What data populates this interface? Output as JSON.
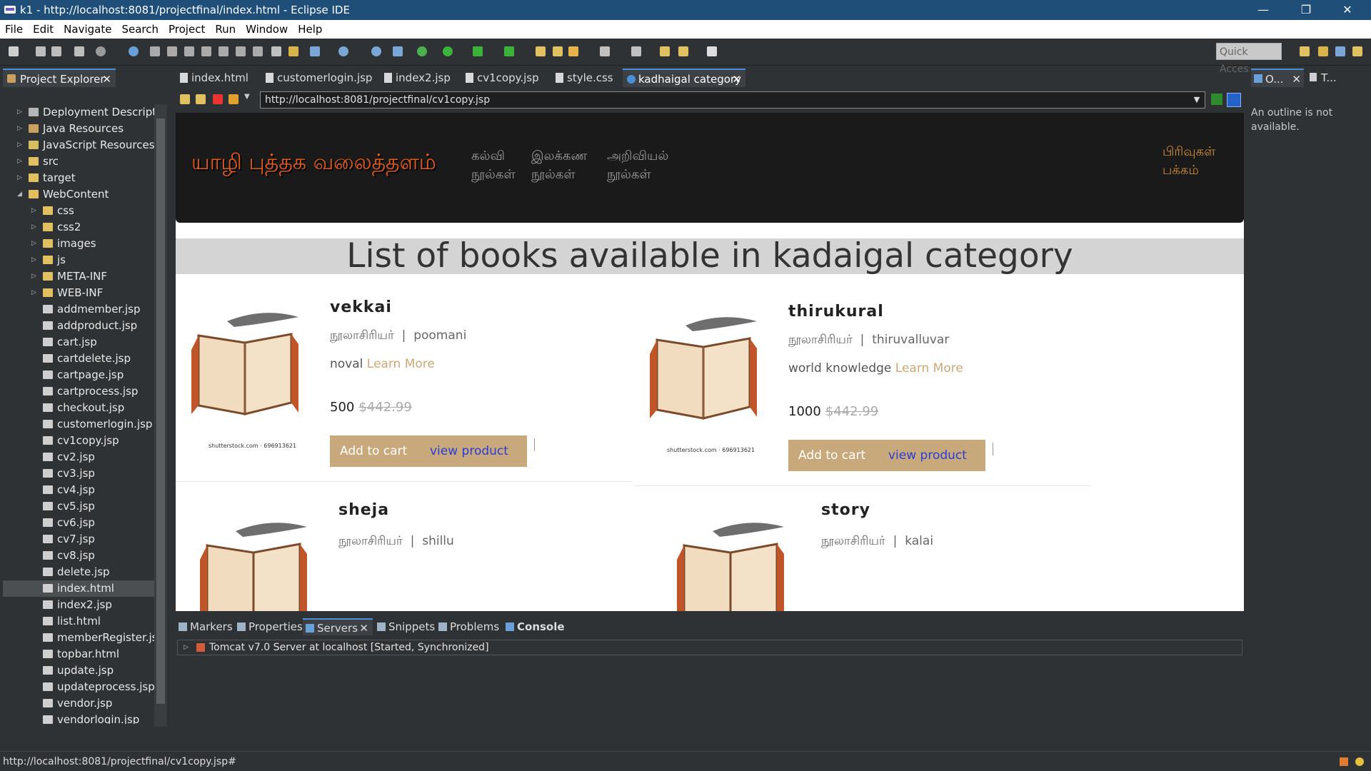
{
  "window": {
    "title": "k1 - http://localhost:8081/projectfinal/index.html - Eclipse IDE",
    "minimize": "—",
    "restore": "❐",
    "close": "✕"
  },
  "menu": [
    "File",
    "Edit",
    "Navigate",
    "Search",
    "Project",
    "Run",
    "Window",
    "Help"
  ],
  "toolbar": {
    "quick_access_placeholder": "Quick Access"
  },
  "explorer": {
    "title": "Project Explorer",
    "close": "✕",
    "items": [
      {
        "label": "Deployment Descriptor",
        "icon": "deployment-icon",
        "arrow": "▷"
      },
      {
        "label": "Java Resources",
        "icon": "java-resources-icon",
        "arrow": "▷"
      },
      {
        "label": "JavaScript Resources",
        "icon": "js-resources-icon",
        "arrow": "▷"
      },
      {
        "label": "src",
        "icon": "folder-icon",
        "arrow": "▷"
      },
      {
        "label": "target",
        "icon": "folder-icon",
        "arrow": "▷"
      },
      {
        "label": "WebContent",
        "icon": "folder-icon",
        "arrow": "◢"
      },
      {
        "label": "css",
        "icon": "folder-icon",
        "arrow": "▷"
      },
      {
        "label": "css2",
        "icon": "folder-icon",
        "arrow": "▷"
      },
      {
        "label": "images",
        "icon": "folder-icon",
        "arrow": "▷"
      },
      {
        "label": "js",
        "icon": "folder-icon",
        "arrow": "▷"
      },
      {
        "label": "META-INF",
        "icon": "folder-icon",
        "arrow": "▷"
      },
      {
        "label": "WEB-INF",
        "icon": "folder-icon",
        "arrow": "▷"
      },
      {
        "label": "addmember.jsp",
        "icon": "file-icon",
        "arrow": ""
      },
      {
        "label": "addproduct.jsp",
        "icon": "file-icon",
        "arrow": ""
      },
      {
        "label": "cart.jsp",
        "icon": "file-icon",
        "arrow": ""
      },
      {
        "label": "cartdelete.jsp",
        "icon": "file-icon",
        "arrow": ""
      },
      {
        "label": "cartpage.jsp",
        "icon": "file-icon",
        "arrow": ""
      },
      {
        "label": "cartprocess.jsp",
        "icon": "file-icon",
        "arrow": ""
      },
      {
        "label": "checkout.jsp",
        "icon": "file-icon",
        "arrow": ""
      },
      {
        "label": "customerlogin.jsp",
        "icon": "file-icon",
        "arrow": ""
      },
      {
        "label": "cv1copy.jsp",
        "icon": "file-icon",
        "arrow": ""
      },
      {
        "label": "cv2.jsp",
        "icon": "file-icon",
        "arrow": ""
      },
      {
        "label": "cv3.jsp",
        "icon": "file-icon",
        "arrow": ""
      },
      {
        "label": "cv4.jsp",
        "icon": "file-icon",
        "arrow": ""
      },
      {
        "label": "cv5.jsp",
        "icon": "file-icon",
        "arrow": ""
      },
      {
        "label": "cv6.jsp",
        "icon": "file-icon",
        "arrow": ""
      },
      {
        "label": "cv7.jsp",
        "icon": "file-icon",
        "arrow": ""
      },
      {
        "label": "cv8.jsp",
        "icon": "file-icon",
        "arrow": ""
      },
      {
        "label": "delete.jsp",
        "icon": "file-icon",
        "arrow": ""
      },
      {
        "label": "index.html",
        "icon": "file-icon",
        "arrow": "",
        "selected": true
      },
      {
        "label": "index2.jsp",
        "icon": "file-icon",
        "arrow": ""
      },
      {
        "label": "list.html",
        "icon": "file-icon",
        "arrow": ""
      },
      {
        "label": "memberRegister.jsp",
        "icon": "file-icon",
        "arrow": ""
      },
      {
        "label": "topbar.html",
        "icon": "file-icon",
        "arrow": ""
      },
      {
        "label": "update.jsp",
        "icon": "file-icon",
        "arrow": ""
      },
      {
        "label": "updateprocess.jsp",
        "icon": "file-icon",
        "arrow": ""
      },
      {
        "label": "vendor.jsp",
        "icon": "file-icon",
        "arrow": ""
      },
      {
        "label": "vendorlogin.jsp",
        "icon": "file-icon",
        "arrow": ""
      }
    ]
  },
  "editor_tabs": [
    {
      "label": "index.html"
    },
    {
      "label": "customerlogin.jsp"
    },
    {
      "label": "index2.jsp"
    },
    {
      "label": "cv1copy.jsp"
    },
    {
      "label": "style.css"
    },
    {
      "label": "kadhaigal category",
      "active": true,
      "close": "✕"
    }
  ],
  "browser": {
    "url": "http://localhost:8081/projectfinal/cv1copy.jsp",
    "url_dropdown": "▼"
  },
  "site": {
    "logo": "யாழி புத்தக வலைத்தளம்",
    "nav": [
      {
        "line1": "கல்வி",
        "line2": "நூல்கள்"
      },
      {
        "line1": "இலக்கண",
        "line2": "நூல்கள்"
      },
      {
        "line1": "அறிவியல்",
        "line2": "நூல்கள்"
      }
    ],
    "nav_right": {
      "line1": "பிரிவுகள்",
      "line2": "பக்கம்"
    },
    "banner": "List of books available in kadaigal category",
    "books": [
      {
        "title": "vekkai",
        "author_label": "நூலாசிரியர்",
        "sep": "|",
        "author": "poomani",
        "category": "noval",
        "learn_more": "Learn More",
        "price": "500",
        "old_price": "$442.99",
        "add": "Add to cart",
        "view": "view product",
        "credit": "shutterstock.com · 696913621"
      },
      {
        "title": "thirukural",
        "author_label": "நூலாசிரியர்",
        "sep": "|",
        "author": "thiruvalluvar",
        "category": "world knowledge",
        "learn_more": "Learn More",
        "price": "1000",
        "old_price": "$442.99",
        "add": "Add to cart",
        "view": "view product",
        "credit": "shutterstock.com · 696913621"
      },
      {
        "title": "sheja",
        "author_label": "நூலாசிரியர்",
        "sep": "|",
        "author": "shillu"
      },
      {
        "title": "story",
        "author_label": "நூலாசிரியர்",
        "sep": "|",
        "author": "kalai"
      }
    ]
  },
  "bottom_tabs": [
    {
      "label": "Markers"
    },
    {
      "label": "Properties"
    },
    {
      "label": "Servers",
      "active": true,
      "close": "✕"
    },
    {
      "label": "Snippets"
    },
    {
      "label": "Problems"
    },
    {
      "label": "Console"
    }
  ],
  "server_row": "Tomcat v7.0 Server at localhost  [Started, Synchronized]",
  "outline": {
    "tab1": "O...",
    "close": "✕",
    "tab2": "T...",
    "message": "An outline is not available."
  },
  "status": "http://localhost:8081/projectfinal/cv1copy.jsp#"
}
